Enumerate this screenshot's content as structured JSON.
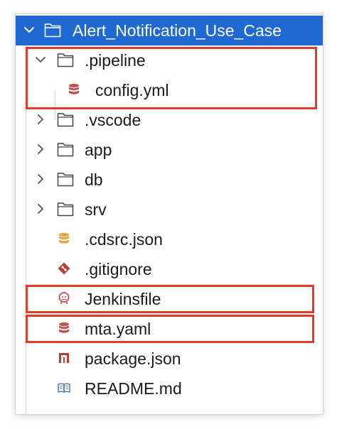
{
  "explorer": {
    "root": {
      "label": "Alert_Notification_Use_Case",
      "icon": "folder-icon",
      "expanded": true
    },
    "items": [
      {
        "label": ".pipeline",
        "icon": "folder-icon",
        "kind": "folder",
        "expanded": true
      },
      {
        "label": "config.yml",
        "icon": "database-icon",
        "kind": "file",
        "icon_color": "#c2504f"
      },
      {
        "label": ".vscode",
        "icon": "folder-icon",
        "kind": "folder",
        "expanded": false
      },
      {
        "label": "app",
        "icon": "folder-icon",
        "kind": "folder",
        "expanded": false
      },
      {
        "label": "db",
        "icon": "folder-icon",
        "kind": "folder",
        "expanded": false
      },
      {
        "label": "srv",
        "icon": "folder-icon",
        "kind": "folder",
        "expanded": false
      },
      {
        "label": ".cdsrc.json",
        "icon": "database-icon",
        "kind": "file",
        "icon_color": "#e8a33c"
      },
      {
        "label": ".gitignore",
        "icon": "git-icon",
        "kind": "file",
        "icon_color": "#b3413a"
      },
      {
        "label": "Jenkinsfile",
        "icon": "jenkins-icon",
        "kind": "file",
        "icon_color": "#c2504f"
      },
      {
        "label": "mta.yaml",
        "icon": "database-icon",
        "kind": "file",
        "icon_color": "#c2504f"
      },
      {
        "label": "package.json",
        "icon": "npm-icon",
        "kind": "file",
        "icon_color": "#b3413a"
      },
      {
        "label": "README.md",
        "icon": "book-icon",
        "kind": "file",
        "icon_color": "#4a7fb8"
      }
    ]
  },
  "colors": {
    "selection": "#1f69d3",
    "highlight_border": "#e23b2a"
  }
}
